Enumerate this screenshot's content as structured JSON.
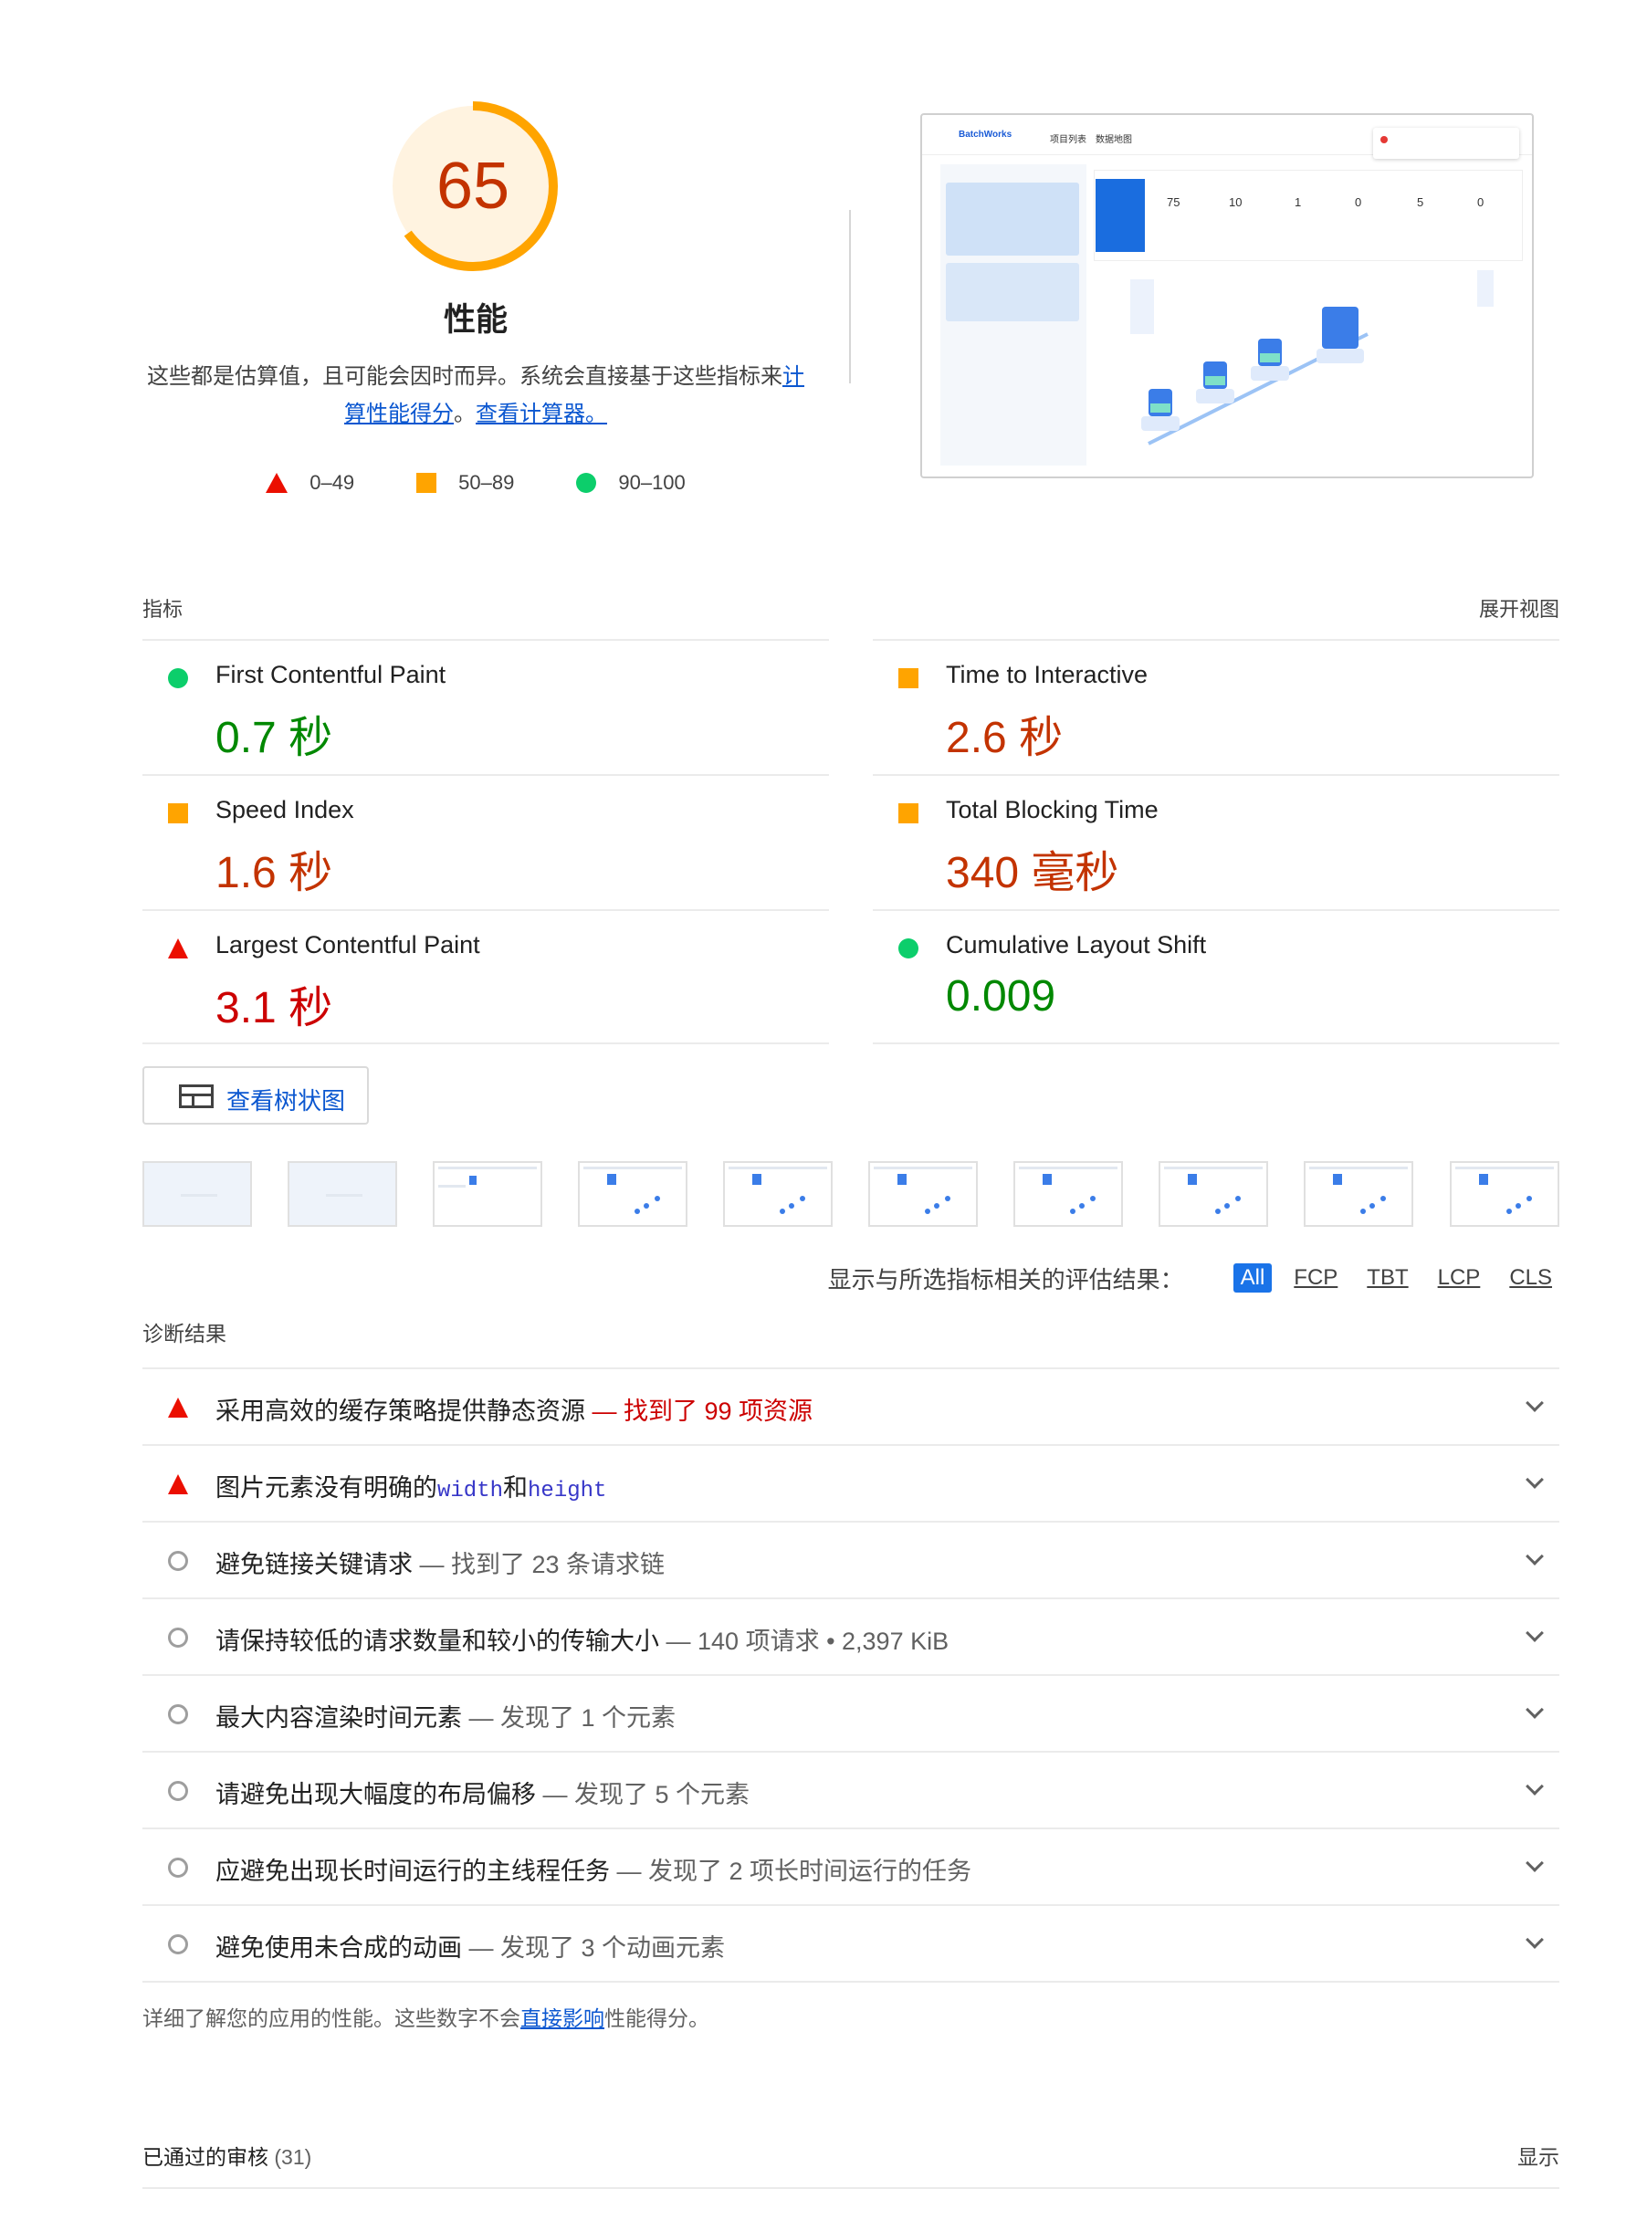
{
  "gauge": {
    "score": "65",
    "score_fraction": 0.65,
    "title": "性能",
    "desc_text": "这些都是估算值，且可能会因时而异。系统会直接基于这些指标来",
    "desc_link1": "计算性能得分",
    "desc_mid": "。",
    "desc_link2": "查看计算器。",
    "color_ring": "#ffa400",
    "color_bg": "#fff3e0"
  },
  "legend": [
    {
      "icon": "triangle-icon",
      "label": "0–49",
      "color": "#eb0f00"
    },
    {
      "icon": "square-icon",
      "label": "50–89",
      "color": "#ffa400"
    },
    {
      "icon": "circle-icon",
      "label": "90–100",
      "color": "#0cce6b"
    }
  ],
  "screenshot": {
    "app_name": "BatchWorks",
    "nav": [
      "项目列表",
      "数据地图"
    ],
    "stats": [
      "75",
      "10",
      "1",
      "0",
      "5",
      "0"
    ]
  },
  "metrics": {
    "header_left": "指标",
    "header_right": "展开视图",
    "items": [
      {
        "name": "First Contentful Paint",
        "value": "0.7 秒",
        "status": "good",
        "icon": "circle-icon"
      },
      {
        "name": "Time to Interactive",
        "value": "2.6 秒",
        "status": "average",
        "icon": "square-icon"
      },
      {
        "name": "Speed Index",
        "value": "1.6 秒",
        "status": "average",
        "icon": "square-icon"
      },
      {
        "name": "Total Blocking Time",
        "value": "340 毫秒",
        "status": "average",
        "icon": "square-icon"
      },
      {
        "name": "Largest Contentful Paint",
        "value": "3.1 秒",
        "status": "fail",
        "icon": "triangle-icon"
      },
      {
        "name": "Cumulative Layout Shift",
        "value": "0.009",
        "status": "good",
        "icon": "circle-icon"
      }
    ]
  },
  "treemap": {
    "label": "查看树状图"
  },
  "filter": {
    "label": "显示与所选指标相关的评估结果：",
    "chips": [
      "All",
      "FCP",
      "TBT",
      "LCP",
      "CLS"
    ],
    "active": "All"
  },
  "diagnostics": {
    "title": "诊断结果",
    "items": [
      {
        "icon": "triangle-icon",
        "title": "采用高效的缓存策略提供静态资源",
        "sep": " — ",
        "detail": "找到了 99 项资源",
        "detail_style": "red"
      },
      {
        "icon": "triangle-icon",
        "title_a": "图片元素没有明确的",
        "code1": "width",
        "title_b": "和",
        "code2": "height"
      },
      {
        "icon": "ring-icon",
        "title": "避免链接关键请求",
        "sep": " — ",
        "detail": "找到了 23 条请求链"
      },
      {
        "icon": "ring-icon",
        "title": "请保持较低的请求数量和较小的传输大小",
        "sep": " — ",
        "detail": "140 项请求 • 2,397 KiB"
      },
      {
        "icon": "ring-icon",
        "title": "最大内容渲染时间元素",
        "sep": " — ",
        "detail": "发现了 1 个元素"
      },
      {
        "icon": "ring-icon",
        "title": "请避免出现大幅度的布局偏移",
        "sep": " — ",
        "detail": "发现了 5 个元素"
      },
      {
        "icon": "ring-icon",
        "title": "应避免出现长时间运行的主线程任务",
        "sep": " — ",
        "detail": "发现了 2 项长时间运行的任务"
      },
      {
        "icon": "ring-icon",
        "title": "避免使用未合成的动画",
        "sep": " — ",
        "detail": "发现了 3 个动画元素"
      }
    ]
  },
  "footer": {
    "text_a": "详细了解您的应用的性能。这些数字不会",
    "link": "直接影响",
    "text_b": "性能得分。"
  },
  "passed": {
    "title": "已通过的审核",
    "count": "(31)",
    "toggle": "显示"
  }
}
